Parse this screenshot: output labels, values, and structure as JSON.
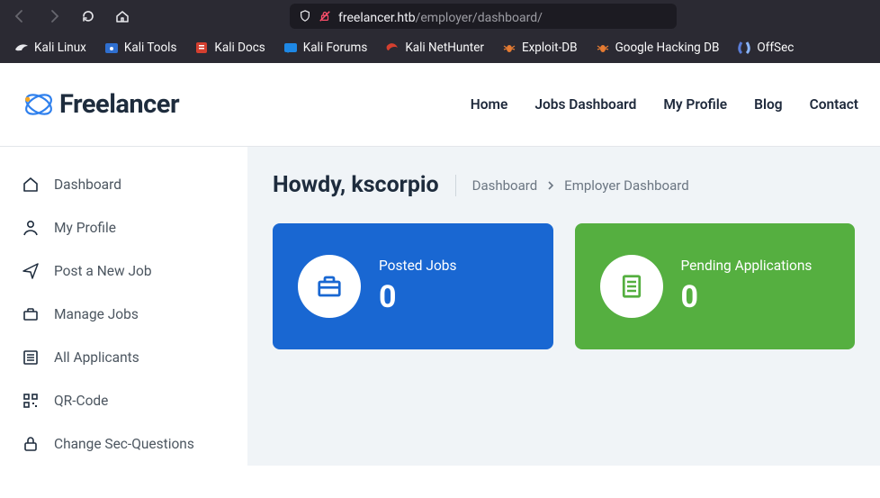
{
  "browser": {
    "url_host": "freelancer.htb",
    "url_path": "/employer/dashboard/",
    "bookmarks": [
      {
        "label": "Kali Linux",
        "color": "#000000"
      },
      {
        "label": "Kali Tools",
        "color": "#2f6fd0"
      },
      {
        "label": "Kali Docs",
        "color": "#d43f2f"
      },
      {
        "label": "Kali Forums",
        "color": "#1e88e5"
      },
      {
        "label": "Kali NetHunter",
        "color": "#d43f2f"
      },
      {
        "label": "Exploit-DB",
        "color": "#e57b32"
      },
      {
        "label": "Google Hacking DB",
        "color": "#e57b32"
      },
      {
        "label": "OffSec",
        "color": "#5a7dd8"
      }
    ]
  },
  "logo": {
    "text": "Freelancer"
  },
  "topnav": {
    "home": "Home",
    "jobs": "Jobs Dashboard",
    "profile": "My Profile",
    "blog": "Blog",
    "contact": "Contact"
  },
  "sidebar": {
    "items": [
      {
        "label": "Dashboard"
      },
      {
        "label": "My Profile"
      },
      {
        "label": "Post a New Job"
      },
      {
        "label": "Manage Jobs"
      },
      {
        "label": "All Applicants"
      },
      {
        "label": "QR-Code"
      },
      {
        "label": "Change Sec-Questions"
      }
    ]
  },
  "headline": "Howdy, kscorpio",
  "crumb": {
    "first": "Dashboard",
    "second": "Employer Dashboard"
  },
  "cards": {
    "posted": {
      "label": "Posted Jobs",
      "value": "0"
    },
    "pending": {
      "label": "Pending Applications",
      "value": "0"
    }
  }
}
